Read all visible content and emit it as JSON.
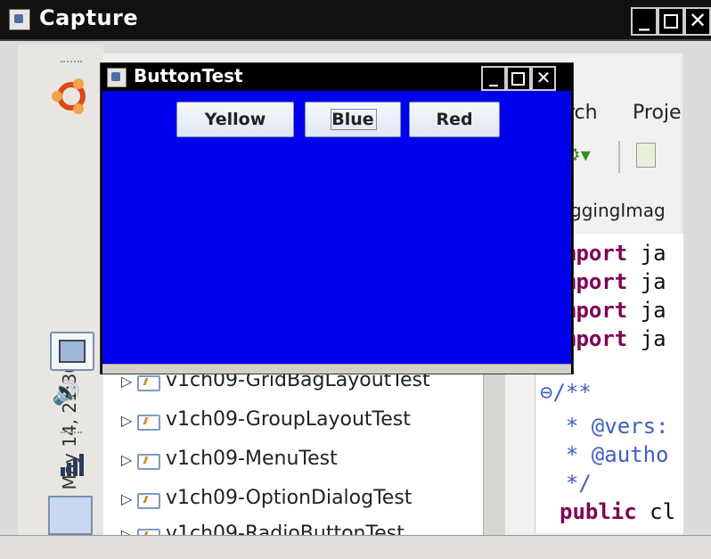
{
  "outer_window": {
    "title": "Capture",
    "controls": {
      "minimize": "_",
      "close": "✕"
    }
  },
  "panel": {
    "clock": "Mon May 14, 21:36"
  },
  "ide": {
    "menu": {
      "search": "rch",
      "project": "Proje"
    },
    "tab": "ggingImag",
    "code_lines": [
      {
        "kw": "mport",
        "rest": " ja"
      },
      {
        "kw": "mport",
        "rest": " ja"
      },
      {
        "kw": "mport",
        "rest": " ja"
      },
      {
        "kw": "mport",
        "rest": " ja"
      }
    ],
    "comment_lines": [
      "⊖/**",
      "  * @vers:",
      "  * @autho",
      "  */"
    ],
    "class_line": {
      "kw": "public",
      "rest": " cl"
    },
    "explorer_items": [
      "v1ch09-GridBagLayoutTest",
      "v1ch09-GroupLayoutTest",
      "v1ch09-MenuTest",
      "v1ch09-OptionDialogTest",
      "v1ch09-RadioButtonTest"
    ]
  },
  "button_test": {
    "title": "ButtonTest",
    "controls": {
      "minimize": "_",
      "close": "✕"
    },
    "background_color": "#0000ee",
    "buttons": {
      "yellow": "Yellow",
      "blue": "Blue",
      "red": "Red"
    }
  }
}
